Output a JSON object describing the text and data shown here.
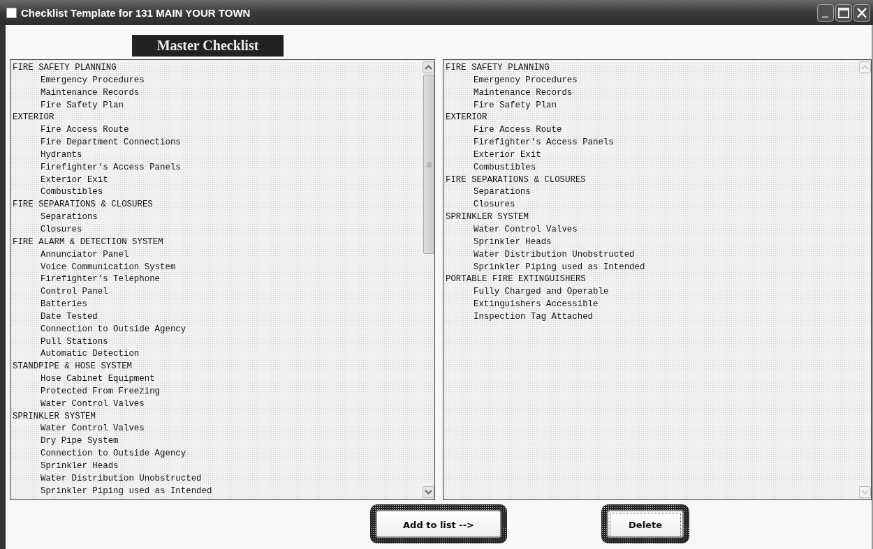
{
  "window": {
    "title": "Checklist Template for 131 MAIN YOUR TOWN"
  },
  "master_heading": "Master Checklist",
  "master_list": {
    "items": [
      {
        "label": "FIRE SAFETY PLANNING",
        "children": [
          {
            "label": "Emergency Procedures"
          },
          {
            "label": "Maintenance Records"
          },
          {
            "label": "Fire Safety Plan"
          }
        ]
      },
      {
        "label": "EXTERIOR",
        "children": [
          {
            "label": "Fire Access Route"
          },
          {
            "label": "Fire Department Connections"
          },
          {
            "label": "Hydrants"
          },
          {
            "label": "Firefighter's Access Panels"
          },
          {
            "label": "Exterior Exit"
          },
          {
            "label": "Combustibles"
          }
        ]
      },
      {
        "label": "FIRE SEPARATIONS & CLOSURES",
        "children": [
          {
            "label": "Separations"
          },
          {
            "label": "Closures"
          }
        ]
      },
      {
        "label": "FIRE ALARM & DETECTION SYSTEM",
        "children": [
          {
            "label": "Annunciator Panel"
          },
          {
            "label": "Voice Communication System"
          },
          {
            "label": "Firefighter's Telephone"
          },
          {
            "label": "Control Panel"
          },
          {
            "label": "Batteries"
          },
          {
            "label": "Date Tested"
          },
          {
            "label": "Connection to Outside Agency"
          },
          {
            "label": "Pull Stations"
          },
          {
            "label": "Automatic Detection"
          }
        ]
      },
      {
        "label": "STANDPIPE & HOSE SYSTEM",
        "children": [
          {
            "label": "Hose Cabinet Equipment"
          },
          {
            "label": "Protected From Freezing"
          },
          {
            "label": "Water Control Valves"
          }
        ]
      },
      {
        "label": "SPRINKLER SYSTEM",
        "children": [
          {
            "label": "Water Control Valves"
          },
          {
            "label": "Dry Pipe System"
          },
          {
            "label": "Connection to Outside Agency"
          },
          {
            "label": "Sprinkler Heads"
          },
          {
            "label": "Water Distribution Unobstructed"
          },
          {
            "label": "Sprinkler Piping used as Intended"
          }
        ]
      }
    ]
  },
  "selected_list": {
    "items": [
      {
        "label": "FIRE SAFETY PLANNING",
        "children": [
          {
            "label": "Emergency Procedures"
          },
          {
            "label": "Maintenance Records"
          },
          {
            "label": "Fire Safety Plan"
          }
        ]
      },
      {
        "label": "EXTERIOR",
        "children": [
          {
            "label": "Fire Access Route"
          },
          {
            "label": "Firefighter's Access Panels"
          },
          {
            "label": "Exterior Exit"
          },
          {
            "label": "Combustibles"
          }
        ]
      },
      {
        "label": "FIRE SEPARATIONS & CLOSURES",
        "children": [
          {
            "label": "Separations"
          },
          {
            "label": "Closures"
          }
        ]
      },
      {
        "label": "SPRINKLER SYSTEM",
        "children": [
          {
            "label": "Water Control Valves"
          },
          {
            "label": "Sprinkler Heads"
          },
          {
            "label": "Water Distribution Unobstructed"
          },
          {
            "label": "Sprinkler Piping used as Intended"
          }
        ]
      },
      {
        "label": "PORTABLE FIRE EXTINGUISHERS",
        "children": [
          {
            "label": "Fully Charged and Operable"
          },
          {
            "label": "Extinguishers Accessible"
          },
          {
            "label": "Inspection Tag Attached"
          }
        ]
      }
    ]
  },
  "buttons": [
    {
      "label": "Add to list -->",
      "focused": false
    },
    {
      "label": "Delete",
      "focused": true
    }
  ]
}
